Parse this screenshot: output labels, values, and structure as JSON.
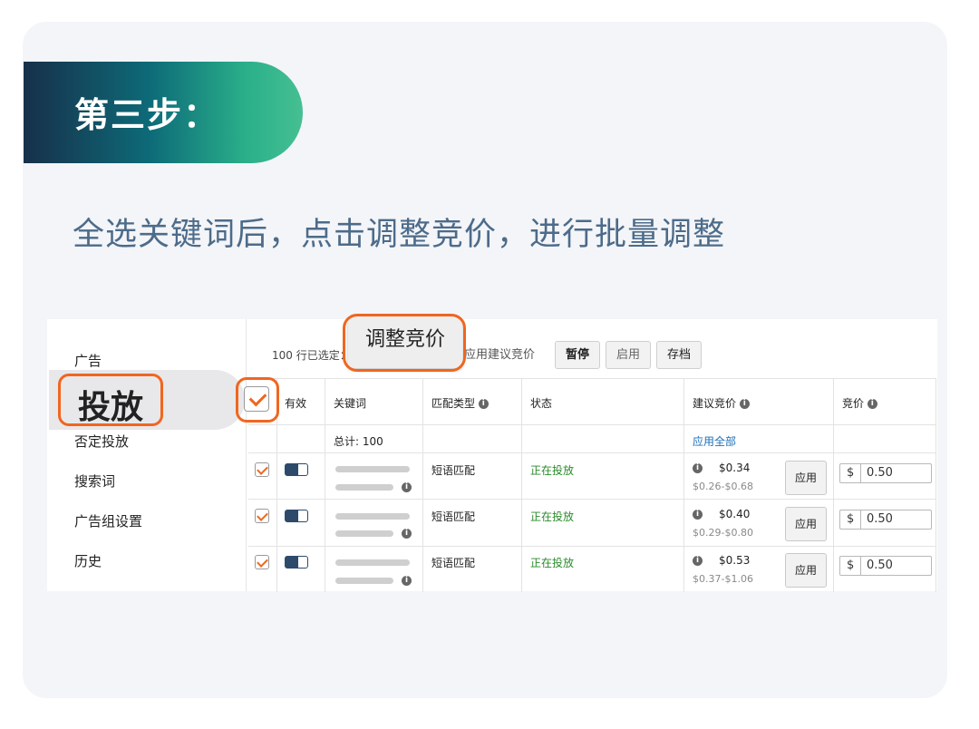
{
  "step": {
    "title": "第三步："
  },
  "instruction": "全选关键词后，点击调整竞价，进行批量调整",
  "sidebar": {
    "items": [
      {
        "label": "广告"
      },
      {
        "label": "投放"
      },
      {
        "label": "否定投放"
      },
      {
        "label": "搜索词"
      },
      {
        "label": "广告组设置"
      },
      {
        "label": "历史"
      }
    ],
    "active_index": 1
  },
  "toolbar": {
    "selected_text": "100 行已选定：",
    "adjust_bid_label": "调整竞价",
    "apply_suggested_label": "应用建议竞价",
    "pause_label": "暂停",
    "enable_label": "启用",
    "archive_label": "存档"
  },
  "table": {
    "headers": {
      "active": "有效",
      "keyword": "关键词",
      "match_type": "匹配类型",
      "status": "状态",
      "suggested_bid": "建议竞价",
      "bid": "竞价"
    },
    "summary": {
      "total": "总计: 100",
      "apply_all": "应用全部"
    },
    "rows": [
      {
        "match_type": "短语匹配",
        "status": "正在投放",
        "suggested": "$0.34",
        "range": "$0.26-$0.68",
        "apply": "应用",
        "currency": "$",
        "bid": "0.50"
      },
      {
        "match_type": "短语匹配",
        "status": "正在投放",
        "suggested": "$0.40",
        "range": "$0.29-$0.80",
        "apply": "应用",
        "currency": "$",
        "bid": "0.50"
      },
      {
        "match_type": "短语匹配",
        "status": "正在投放",
        "suggested": "$0.53",
        "range": "$0.37-$1.06",
        "apply": "应用",
        "currency": "$",
        "bid": "0.50"
      }
    ]
  },
  "colors": {
    "highlight": "#f0661f",
    "status_active": "#2a8a2a",
    "link": "#1b6fb8"
  }
}
